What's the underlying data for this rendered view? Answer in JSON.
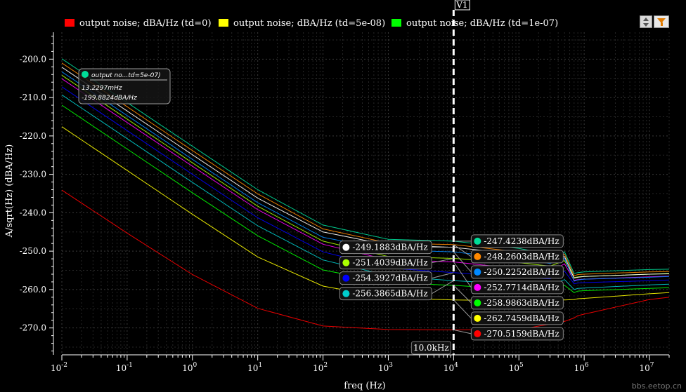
{
  "chart_data": {
    "type": "line",
    "xscale": "log",
    "xlabel": "freq (Hz)",
    "ylabel": "A/sqrt(Hz) (dBA/Hz)",
    "xlim": [
      0.01,
      20000000
    ],
    "ylim": [
      -277,
      -193
    ],
    "y_ticks": [
      -200,
      -210,
      -220,
      -230,
      -240,
      -250,
      -260,
      -270
    ],
    "y_tick_labels": [
      "-200.0",
      "-210.0",
      "-220.0",
      "-230.0",
      "-240.0",
      "-250.0",
      "-260.0",
      "-270.0"
    ],
    "x_ticks": [
      0.01,
      0.1,
      1,
      10,
      100,
      1000,
      10000,
      100000,
      1000000,
      10000000
    ],
    "x_tick_labels": [
      "10-2",
      "10-1",
      "100",
      "101",
      "102",
      "103",
      "104",
      "105",
      "106",
      "107"
    ],
    "grid": true,
    "legend_position": "top",
    "legend": [
      {
        "label": "output noise; dBA/Hz (td=0)",
        "color": "#ff0000"
      },
      {
        "label": "output noise; dBA/Hz (td=5e-08)",
        "color": "#ffff00"
      },
      {
        "label": "output noise; dBA/Hz (td=1e-07)",
        "color": "#00ff00"
      }
    ],
    "x": [
      0.01,
      0.1,
      1,
      10,
      100,
      1000,
      10000,
      100000,
      300000,
      500000,
      700000,
      800000,
      1000000,
      10000000,
      20000000
    ],
    "series": [
      {
        "color": "#ff0000",
        "values": [
          -234.1,
          -245.3,
          -256.1,
          -264.9,
          -269.5,
          -270.4,
          -270.5,
          -270.4,
          -269.0,
          -268.3,
          -267.4,
          -266.8,
          -266.4,
          -262.6,
          -262.0
        ],
        "label_at_cursor": "-270.5159dBA/Hz",
        "label_side": "right"
      },
      {
        "color": "#ffff00",
        "values": [
          -217.6,
          -229.0,
          -240.4,
          -251.5,
          -259.1,
          -262.2,
          -262.7,
          -262.9,
          -262.5,
          -262.7,
          -262.6,
          -262.4,
          -262.3,
          -261.1,
          -260.8
        ],
        "label_at_cursor": "-262.7459dBA/Hz",
        "label_side": "right"
      },
      {
        "color": "#00cccc",
        "values": [
          -209.3,
          -220.7,
          -232.1,
          -243.4,
          -252.3,
          -256.4,
          -257.7,
          -258.6,
          -258.9,
          -257.4,
          -260.0,
          -259.7,
          -259.6,
          -258.8,
          -258.6
        ],
        "label_at_cursor": "-256.3865dBA/Hz",
        "label_side": "left"
      },
      {
        "color": "#00ff00",
        "values": [
          -212.0,
          -223.4,
          -234.8,
          -246.0,
          -254.9,
          -258.2,
          -258.9,
          -260.0,
          -260.2,
          -258.9,
          -260.8,
          -260.4,
          -260.3,
          -259.7,
          -259.5
        ],
        "label_at_cursor": "-258.9863dBA/Hz",
        "label_side": "right"
      },
      {
        "color": "#0000ff",
        "values": [
          -207.2,
          -218.6,
          -230.0,
          -241.3,
          -250.2,
          -254.4,
          -255.6,
          -256.8,
          -257.2,
          -255.2,
          -258.5,
          -258.3,
          -258.2,
          -257.7,
          -257.5
        ],
        "label_at_cursor": "-254.3927dBA/Hz",
        "label_side": "left"
      },
      {
        "color": "#ff00ff",
        "values": [
          -205.1,
          -216.5,
          -227.9,
          -239.2,
          -248.2,
          -252.3,
          -252.8,
          -254.6,
          -255.4,
          -253.3,
          -257.6,
          -257.4,
          -257.3,
          -256.7,
          -256.5
        ],
        "label_at_cursor": "-252.7714dBA/Hz",
        "label_side": "right"
      },
      {
        "color": "#aaff00",
        "values": [
          -204.2,
          -215.6,
          -227.0,
          -238.3,
          -247.4,
          -251.4,
          -251.9,
          -253.0,
          -253.9,
          -252.5,
          -256.9,
          -256.7,
          -256.6,
          -256.0,
          -255.8
        ],
        "label_at_cursor": "-251.4039dBA/Hz",
        "label_side": "left"
      },
      {
        "color": "#0088ff",
        "values": [
          -203.3,
          -214.7,
          -226.1,
          -237.4,
          -246.4,
          -249.7,
          -250.2,
          -252.1,
          -253.2,
          -251.9,
          -257.8,
          -257.5,
          -257.3,
          -256.8,
          -256.6
        ],
        "label_at_cursor": "-250.2252dBA/Hz",
        "label_side": "right"
      },
      {
        "color": "#ffffff",
        "values": [
          -202.1,
          -213.5,
          -224.9,
          -236.2,
          -245.0,
          -248.4,
          -249.0,
          -250.8,
          -252.1,
          -251.4,
          -257.0,
          -256.8,
          -256.6,
          -256.0,
          -255.9
        ],
        "label_at_cursor": "-249.1883dBA/Hz",
        "label_side": "left"
      },
      {
        "color": "#ff8800",
        "values": [
          -201.0,
          -212.4,
          -223.8,
          -235.1,
          -244.2,
          -247.9,
          -248.3,
          -250.2,
          -251.5,
          -250.8,
          -256.4,
          -256.1,
          -256.0,
          -255.4,
          -255.3
        ],
        "label_at_cursor": "-248.2603dBA/Hz",
        "label_side": "right"
      },
      {
        "color": "#00dd99",
        "values": [
          -199.9,
          -211.3,
          -222.7,
          -234.0,
          -243.2,
          -246.9,
          -247.4,
          -249.3,
          -250.8,
          -250.2,
          -255.8,
          -255.6,
          -255.4,
          -254.8,
          -254.7
        ],
        "label_at_cursor": "-247.4238dBA/Hz",
        "label_side": "right"
      }
    ],
    "cursor": {
      "name": "V1",
      "x": 10000,
      "label": "10.0kHz"
    },
    "tooltip": {
      "title": "output no...td=5e-07)",
      "x_value": "13.2297mHz",
      "y_value": "-199.8824dBA/Hz",
      "color": "#00dd99"
    }
  },
  "watermark": "bbs.eetop.cn"
}
